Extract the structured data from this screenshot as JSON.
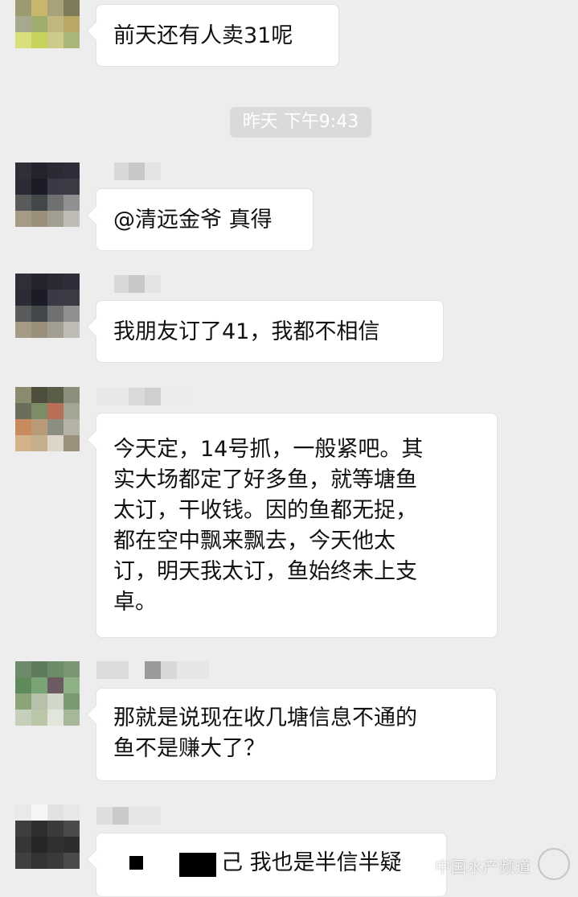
{
  "messages": [
    {
      "text": "前天还有人卖31呢"
    },
    {
      "text": "@清远金爷 真得"
    },
    {
      "text": "我朋友订了41，我都不相信"
    },
    {
      "text": "今天定，14号抓，一般紧吧。其\n实大场都定了好多鱼，就等塘鱼\n太订，干收钱。因的鱼都无捉，\n都在空中飘来飘去，今天他太\n订，明天我太订，鱼始终未上支\n卓。"
    },
    {
      "text": "那就是说现在收几塘信息不通的\n鱼不是赚大了？"
    },
    {
      "text": "己 我也是半信半疑"
    }
  ],
  "timestamp": "昨天 下午9:43",
  "watermark": "中国水产频道"
}
